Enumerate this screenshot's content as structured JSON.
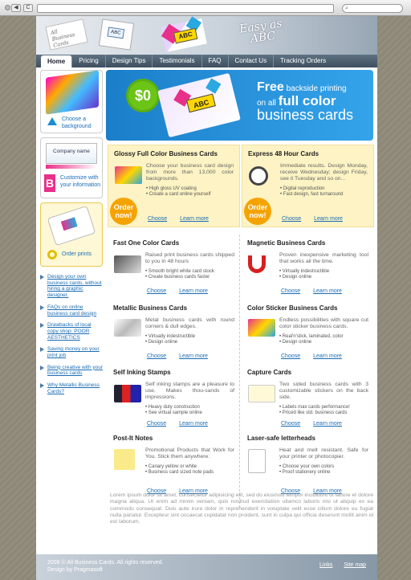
{
  "browser": {
    "back_label": "◀",
    "fwd_label": "▶",
    "reload_label": "C",
    "search_icon": "search-icon"
  },
  "header": {
    "card_text": "All Business Cards",
    "logo_text": "ABC",
    "tagline_line1": "Easy as",
    "tagline_line2": "ABC"
  },
  "nav": {
    "items": [
      "Home",
      "Pricing",
      "Design Tips",
      "Testimonials",
      "FAQ",
      "Contact Us",
      "Tracking Orders"
    ]
  },
  "sidebar": {
    "background_label": "Choose a background",
    "company_name": "Company name",
    "customize_label": "Customize with your information",
    "order_label": "Order prints",
    "b_letter": "B",
    "links": [
      "Design your own business cards, without hiring a graphic designer.",
      "FAQs on online business card design",
      "Drawbacks of local copy shop: POOR AESTHETICS",
      "Saving money on your print job",
      "Being creative with your business cards",
      "Why Metallic Business Cards?"
    ]
  },
  "banner": {
    "price": "$0",
    "logo_text": "ABC",
    "line1": "Free",
    "line1_small": " backside printing",
    "line2_pre": "on all ",
    "line2_big": "full color",
    "line3": "business cards"
  },
  "products": [
    {
      "title": "Glossy Full Color Business Cards",
      "desc": "Choose your business card design from more than 13,000 color backgrounds.",
      "bullets": [
        "High gloss UV coating",
        "Create a card online yourself"
      ],
      "choose": "Choose",
      "learn": "Learn more",
      "badge": "Order now!"
    },
    {
      "title": "Express 48 Hour Cards",
      "desc": "Immediate results. Design Monday, receive Wednesday; design Friday, see it Tuesday and so on...",
      "bullets": [
        "Digital reproduction",
        "Fast design, fast turnaround"
      ],
      "choose": "Choose",
      "learn": "Learn more",
      "badge": "Order now!"
    },
    {
      "title": "Fast One Color Cards",
      "desc": "Raised print business cards shipped to you in 48 hours",
      "bullets": [
        "Smooth bright white card stock",
        "Create business cards faster"
      ],
      "choose": "Choose",
      "learn": "Learn more"
    },
    {
      "title": "Magnetic Business Cards",
      "desc": "Proven inexpensive marketing tool that works all the time.",
      "bullets": [
        "Virtually indestructible",
        "Design online"
      ],
      "choose": "Choose",
      "learn": "Learn more"
    },
    {
      "title": "Metallic Business Cards",
      "desc": "Metal business cards with round corners & dull edges.",
      "bullets": [
        "Virtually indestructible",
        "Design online"
      ],
      "choose": "Choose",
      "learn": "Learn more"
    },
    {
      "title": "Color Sticker Business Cards",
      "desc": "Endless possibilities with square cut color sticker business cards.",
      "bullets": [
        "Real'n'stick, laminated, color",
        "Design online"
      ],
      "choose": "Choose",
      "learn": "Learn more"
    },
    {
      "title": "Self Inking Stamps",
      "desc": "Self inking stamps are a pleasure to use. Makes thou-sands of impressions.",
      "bullets": [
        "Heavy duty construction",
        "See virtual sample online"
      ],
      "choose": "Choose",
      "learn": "Learn more"
    },
    {
      "title": "Capture Cards",
      "desc": "Two sided business cards with 3 customizable stickers on the back side.",
      "bullets": [
        "Labels max cards performance!",
        "Priced like std. business cards"
      ],
      "choose": "Choose",
      "learn": "Learn more"
    },
    {
      "title": "Post-It Notes",
      "desc": "Promotional Products that Work for You. Stick them anywhere.",
      "bullets": [
        "Canary yellow or white",
        "Business card sized note pads"
      ],
      "choose": "Choose",
      "learn": "Learn more"
    },
    {
      "title": "Laser-safe letterheads",
      "desc": "Heat and melt resistant. Safe for your printer or photocopier.",
      "bullets": [
        "Choose your own colors",
        "Proof stationery online"
      ],
      "choose": "Choose",
      "learn": "Learn more"
    }
  ],
  "lorem": "Lorem ipsum dolor sit amet, consectetur adipisicing elit, sed do eiusmod tempor incididunt ut labore et dolore magna aliqua. Ut enim ad minim veniam, quis nostrud exercitation ullamco laboris nisi ut aliquip ex ea commodo consequat. Duis aute irure dolor in reprehenderit in voluptate velit esse cillum dolore eu fugiat nulla pariatur. Excepteur sint occaecat cupidatat non proident, sunt in culpa qui officia deserunt mollit anim id est laborum.",
  "footer": {
    "copyright": "2008 © All Business Cards. All rights reserved.",
    "credit": "Design by Pragmasoft",
    "links_label": "Links",
    "sitemap_label": "Site map"
  }
}
